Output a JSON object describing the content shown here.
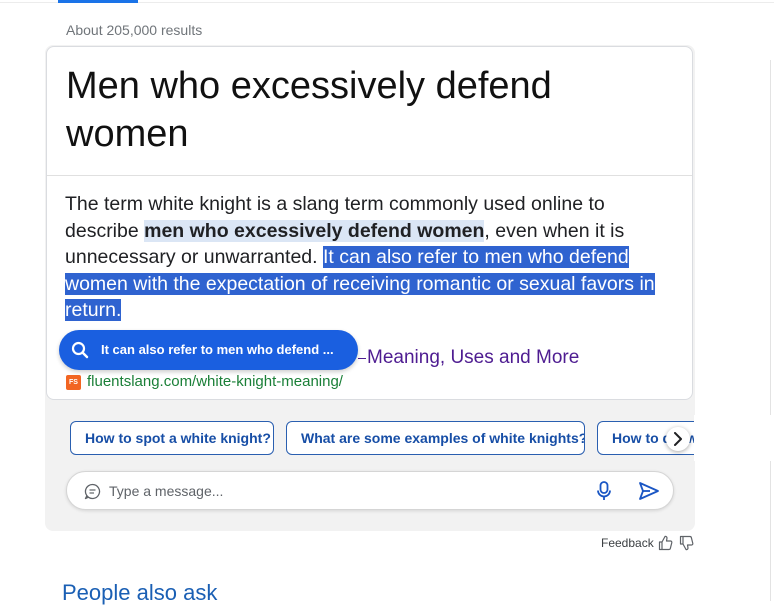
{
  "search": {
    "result_count": "About 205,000 results"
  },
  "answer": {
    "title": "Men who excessively defend women",
    "snippet": {
      "part1": "The term white knight is a slang term commonly used online to describe ",
      "bold_highlight": "men who excessively defend women",
      "part2": ", even when it is unnecessary or unwarranted.",
      "gap": " ",
      "selected": "It can also refer to men who defend women with the expectation of receiving romantic or sexual favors in return."
    },
    "selection_pill": {
      "label": "It can also refer to men who defend ..."
    },
    "source": {
      "title_fragment": "Meaning, Uses and More",
      "favicon_text": "FS",
      "url": "fluentslang.com/white-knight-meaning/"
    }
  },
  "suggestions": [
    "How to spot a white knight?",
    "What are some examples of white knights?",
    "How to d... w"
  ],
  "composer": {
    "placeholder": "Type a message..."
  },
  "feedback": {
    "label": "Feedback"
  },
  "people_also_ask": {
    "heading": "People also ask"
  },
  "colors": {
    "accent_blue": "#1a5fe0",
    "selection_blue": "#2f63d0",
    "link_purple": "#4e1c91",
    "url_green": "#1a7f37",
    "chip_text": "#174ea6"
  }
}
